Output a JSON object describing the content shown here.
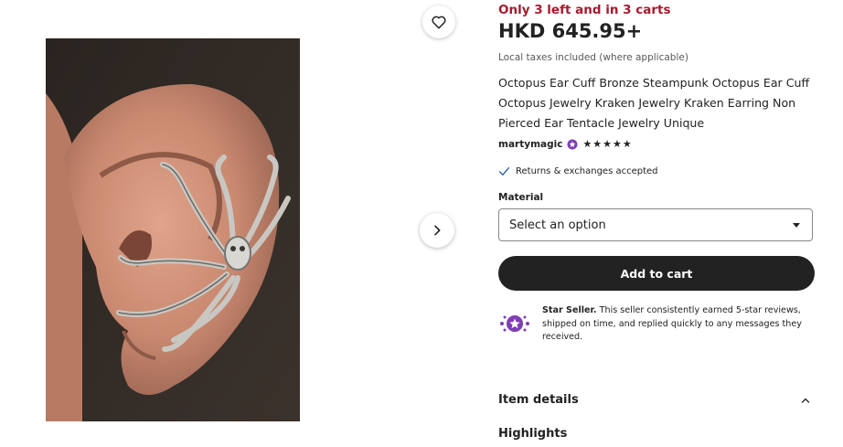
{
  "listing": {
    "stock_message": "Only 3 left and in 3 carts",
    "price": "HKD 645.95+",
    "tax_note": "Local taxes included (where applicable)",
    "title": "Octopus Ear Cuff Bronze Steampunk Octopus Ear Cuff Octopus Jewelry Kraken Jewelry Kraken Earring Non Pierced Ear Tentacle Jewelry Unique"
  },
  "shop": {
    "name": "martymagic",
    "rating": 5,
    "stars": "★★★★★"
  },
  "returns": "Returns & exchanges accepted",
  "material": {
    "label": "Material",
    "selected": "Select an option"
  },
  "cart_button": "Add to cart",
  "star_seller": {
    "title": "Star Seller.",
    "text": "This seller consistently earned 5-star reviews, shipped on time, and replied quickly to any messages they received."
  },
  "sections": {
    "item_details": "Item details",
    "highlights": "Highlights"
  },
  "icons": {
    "favorite": "heart-icon",
    "next": "chevron-right-icon",
    "dropdown": "caret-down-icon",
    "check": "check-icon",
    "collapse": "chevron-up-icon",
    "badge": "star-seller-badge-icon"
  },
  "colors": {
    "stock": "#a61a2e",
    "accent": "#7f3db5",
    "check": "#2f5fb3",
    "button": "#222222"
  }
}
